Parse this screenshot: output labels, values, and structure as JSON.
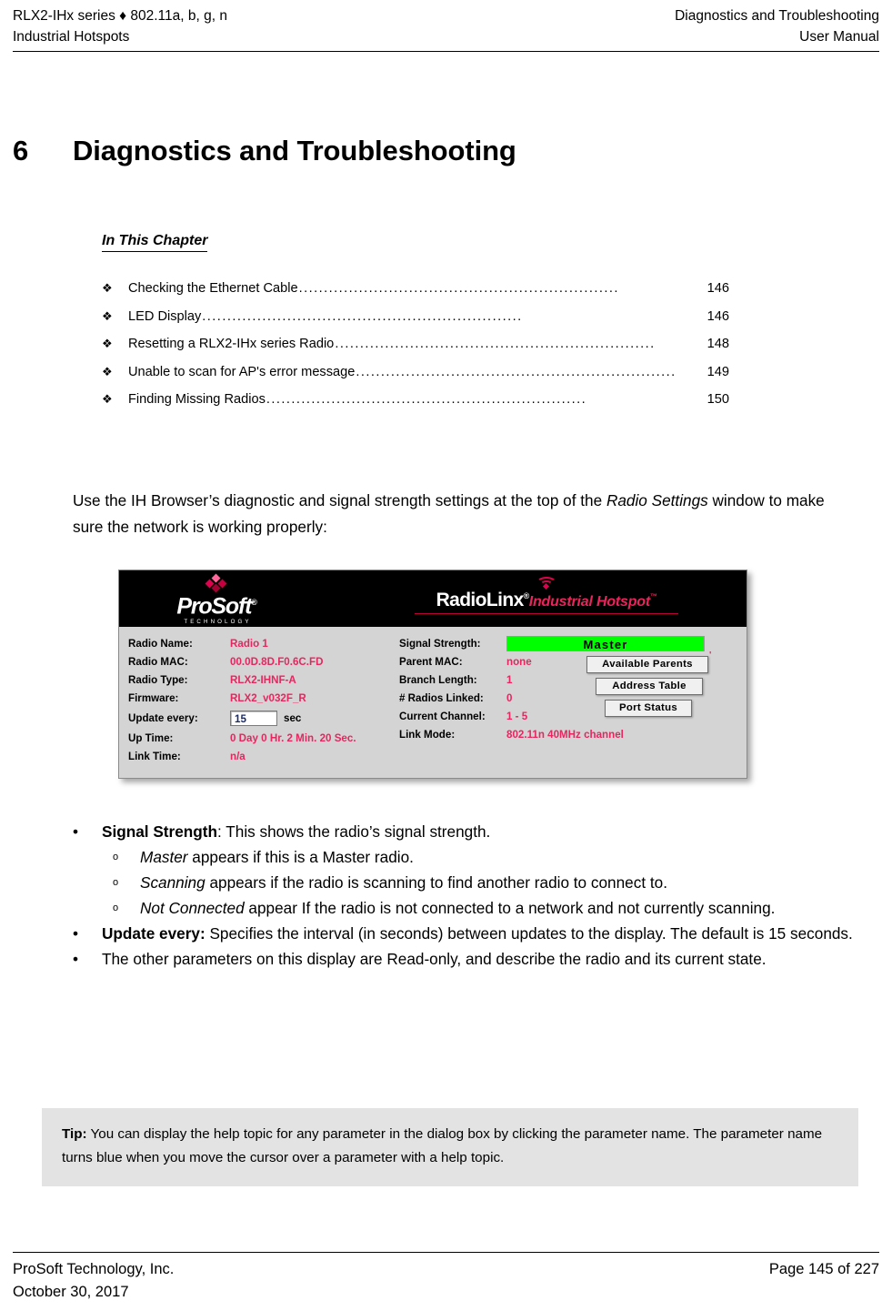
{
  "header": {
    "left_line1": "RLX2-IHx series ♦ 802.11a, b, g, n",
    "left_line2": "Industrial Hotspots",
    "right_line1": "Diagnostics and Troubleshooting",
    "right_line2": "User Manual"
  },
  "chapter": {
    "number": "6",
    "title": "Diagnostics and Troubleshooting"
  },
  "in_this_chapter": {
    "heading": "In This Chapter",
    "bullet": "❖",
    "entries": [
      {
        "label": "Checking the Ethernet Cable",
        "page": "146",
        "dots": "................................................................"
      },
      {
        "label": "LED Display",
        "page": "146",
        "dots": "................................................................"
      },
      {
        "label": "Resetting a RLX2-IHx series Radio",
        "page": "148",
        "dots": "................................................................"
      },
      {
        "label": "Unable to scan for AP's error message",
        "page": "149",
        "dots": "................................................................"
      },
      {
        "label": "Finding Missing Radios",
        "page": "150",
        "dots": "................................................................"
      }
    ]
  },
  "intro": {
    "part1": "Use the IH Browser’s diagnostic and signal strength settings at the top of the ",
    "italic": "Radio Settings",
    "part2": " window to make sure the network is working properly:"
  },
  "figure": {
    "brand": {
      "prosoft_word": "ProSoft",
      "prosoft_reg": "®",
      "prosoft_sub": "TECHNOLOGY",
      "radiolinx_word": "RadioLinx",
      "radiolinx_reg": "®",
      "radiolinx_tagline": "Industrial Hotspot",
      "radiolinx_tm": "™"
    },
    "left_fields": [
      {
        "label": "Radio Name:",
        "value": "Radio 1"
      },
      {
        "label": "Radio MAC:",
        "value": "00.0D.8D.F0.6C.FD"
      },
      {
        "label": "Radio Type:",
        "value": "RLX2-IHNF-A"
      },
      {
        "label": "Firmware:",
        "value": "RLX2_v032F_R"
      }
    ],
    "update_every": {
      "label": "Update every:",
      "value": "15",
      "unit": "sec"
    },
    "left_fields_tail": [
      {
        "label": "Up Time:",
        "value": "0 Day 0 Hr. 2 Min. 20 Sec."
      },
      {
        "label": "Link Time:",
        "value": "n/a"
      }
    ],
    "signal_strength": {
      "label": "Signal Strength:",
      "value": "Master",
      "bar_color": "#00ff00",
      "tick": "'"
    },
    "right_fields": [
      {
        "label": "Parent MAC:",
        "value": "none"
      },
      {
        "label": "Branch Length:",
        "value": "1"
      },
      {
        "label": "# Radios Linked:",
        "value": "0"
      },
      {
        "label": "Current Channel:",
        "value": "1 - 5"
      },
      {
        "label": "Link Mode:",
        "value": "802.11n 40MHz channel"
      }
    ],
    "buttons": [
      {
        "label": "Available Parents"
      },
      {
        "label": "Address Table"
      },
      {
        "label": "Port Status"
      }
    ]
  },
  "bullets": [
    {
      "level": 1,
      "mark": "•",
      "bold": "Signal Strength",
      "text": ": This shows the radio’s signal strength."
    },
    {
      "level": 2,
      "mark": "o",
      "italic": "Master",
      "text": " appears if this is a Master radio."
    },
    {
      "level": 2,
      "mark": "o",
      "italic": "Scanning",
      "text": " appears if the radio is scanning to find another radio to connect to."
    },
    {
      "level": 2,
      "mark": "o",
      "italic": "Not Connected",
      "text": " appear If the radio is not connected to a network and not currently scanning."
    },
    {
      "level": 1,
      "mark": "•",
      "bold": "Update every:",
      "text": " Specifies the interval (in seconds) between updates to the display. The default is 15 seconds."
    },
    {
      "level": 1,
      "mark": "•",
      "bold": "",
      "text": "The other parameters on this display are Read-only, and describe the radio and its current state."
    }
  ],
  "tip": {
    "bold": "Tip:",
    "text": " You can display the help topic for any parameter in the dialog box by clicking the parameter name. The parameter name turns blue when you move the cursor over a parameter with a help topic."
  },
  "footer": {
    "left_line1": "ProSoft Technology, Inc.",
    "left_line2": "October 30, 2017",
    "right_line1": "Page 145 of 227"
  }
}
